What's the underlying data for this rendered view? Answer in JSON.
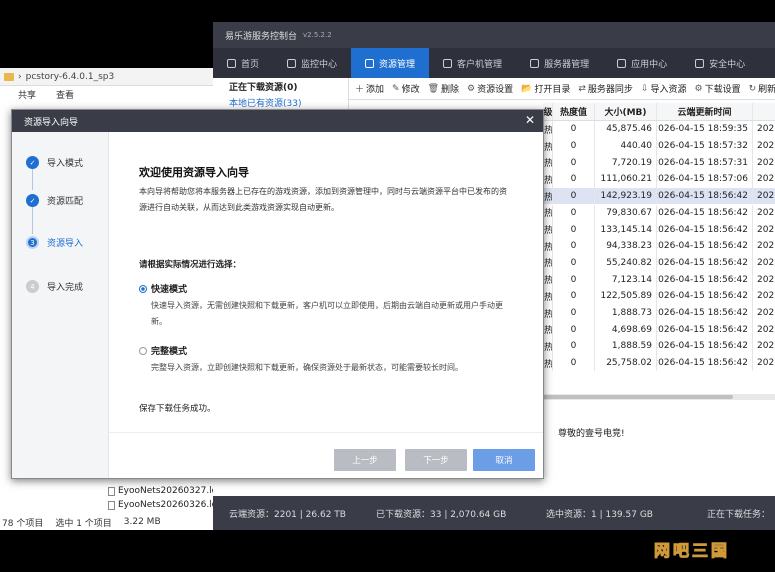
{
  "explorer": {
    "path": "pcstory-6.4.0.1_sp3",
    "ribbon": [
      "共享",
      "查看"
    ],
    "files": [
      "EyooNets20260327.lo",
      "EyooNets20260326.lo"
    ],
    "status": {
      "items": "78 个项目",
      "selected": "选中 1 个项目",
      "size": "3.22 MB"
    }
  },
  "app": {
    "title": "易乐游服务控制台",
    "version": "v2.5.2.2",
    "nav": [
      {
        "label": "首页",
        "icon": "home-icon"
      },
      {
        "label": "监控中心",
        "icon": "monitor-icon"
      },
      {
        "label": "资源管理",
        "icon": "resource-icon",
        "active": true
      },
      {
        "label": "客户机管理",
        "icon": "computer-icon"
      },
      {
        "label": "服务器管理",
        "icon": "server-icon"
      },
      {
        "label": "应用中心",
        "icon": "app-icon"
      },
      {
        "label": "安全中心",
        "icon": "shield-icon"
      }
    ],
    "left_list": [
      "正在下载资源(0)",
      "本地已有资源(33)"
    ],
    "toolbar": [
      {
        "label": "添加",
        "icon": "＋"
      },
      {
        "label": "修改",
        "icon": "✎"
      },
      {
        "label": "删除",
        "icon": "🗑"
      },
      {
        "label": "资源设置",
        "icon": "⚙"
      },
      {
        "label": "打开目录",
        "icon": "📂"
      },
      {
        "label": "服务器同步",
        "icon": "⇄"
      },
      {
        "label": "导入资源",
        "icon": "⇩"
      },
      {
        "label": "下载设置",
        "icon": "⚙"
      },
      {
        "label": "刷新",
        "icon": "↻"
      }
    ],
    "grid": {
      "headers": [
        "级",
        "热度值",
        "大小(MB)",
        "云端更新时间",
        ""
      ],
      "rows": [
        {
          "level": "热",
          "heat": "0",
          "size": "45,875.46",
          "time": "2026-04-15 18:59:35",
          "extra": "202"
        },
        {
          "level": "热",
          "heat": "0",
          "size": "440.40",
          "time": "2026-04-15 18:57:32",
          "extra": "202"
        },
        {
          "level": "热",
          "heat": "0",
          "size": "7,720.19",
          "time": "2026-04-15 18:57:31",
          "extra": "202"
        },
        {
          "level": "热",
          "heat": "0",
          "size": "111,060.21",
          "time": "2026-04-15 18:57:06",
          "extra": "202"
        },
        {
          "level": "热",
          "heat": "0",
          "size": "142,923.19",
          "time": "2026-04-15 18:56:42",
          "extra": "202"
        },
        {
          "level": "热",
          "heat": "0",
          "size": "79,830.67",
          "time": "2026-04-15 18:56:42",
          "extra": "202"
        },
        {
          "level": "热",
          "heat": "0",
          "size": "133,145.14",
          "time": "2026-04-15 18:56:42",
          "extra": "202"
        },
        {
          "level": "热",
          "heat": "0",
          "size": "94,338.23",
          "time": "2026-04-15 18:56:42",
          "extra": "202"
        },
        {
          "level": "热",
          "heat": "0",
          "size": "55,240.82",
          "time": "2026-04-15 18:56:42",
          "extra": "202"
        },
        {
          "level": "热",
          "heat": "0",
          "size": "7,123.14",
          "time": "2026-04-15 18:56:42",
          "extra": "202"
        },
        {
          "level": "热",
          "heat": "0",
          "size": "122,505.89",
          "time": "2026-04-15 18:56:42",
          "extra": "202"
        },
        {
          "level": "热",
          "heat": "0",
          "size": "1,888.73",
          "time": "2026-04-15 18:56:42",
          "extra": "202"
        },
        {
          "level": "热",
          "heat": "0",
          "size": "4,698.69",
          "time": "2026-04-15 18:56:42",
          "extra": "202"
        },
        {
          "level": "热",
          "heat": "0",
          "size": "1,888.59",
          "time": "2026-04-15 18:56:42",
          "extra": "202"
        },
        {
          "level": "热",
          "heat": "0",
          "size": "25,758.02",
          "time": "2026-04-15 18:56:42",
          "extra": "202"
        }
      ]
    },
    "log": {
      "msg": "尊敬的壹号电竞!"
    },
    "statusbar": {
      "cloud": "云端资源：2201 | 26.62 TB",
      "downloaded": "已下载资源：33 | 2,070.64 GB",
      "selected": "选中资源：1 | 139.57 GB",
      "running": "正在下载任务："
    }
  },
  "wizard": {
    "title": "资源导入向导",
    "steps": [
      {
        "num": "✓",
        "label": "导入模式",
        "state": "done"
      },
      {
        "num": "✓",
        "label": "资源匹配",
        "state": "done"
      },
      {
        "num": "3",
        "label": "资源导入",
        "state": "cur"
      },
      {
        "num": "4",
        "label": "导入完成",
        "state": "todo"
      }
    ],
    "heading": "欢迎使用资源导入向导",
    "intro": "本向导将帮助您将本服务器上已存在的游戏资源，添加到资源管理中，同时与云端资源平台中已发布的资源进行自动关联，从而达到此类游戏资源实现自动更新。",
    "choose": "请根据实际情况进行选择：",
    "options": [
      {
        "label": "快速模式",
        "desc": "快速导入资源，无需创建快照和下载更新，客户机可以立即使用，后期由云端自动更新或用户手动更新。",
        "selected": true
      },
      {
        "label": "完整模式",
        "desc": "完整导入资源，立即创建快照和下载更新，确保资源处于最新状态，可能需要较长时间。",
        "selected": false
      }
    ],
    "result": "保存下载任务成功。",
    "buttons": {
      "prev": "上一步",
      "next": "下一步",
      "cancel": "取消"
    }
  },
  "watermark": [
    "网",
    "吧",
    "三",
    "国"
  ]
}
